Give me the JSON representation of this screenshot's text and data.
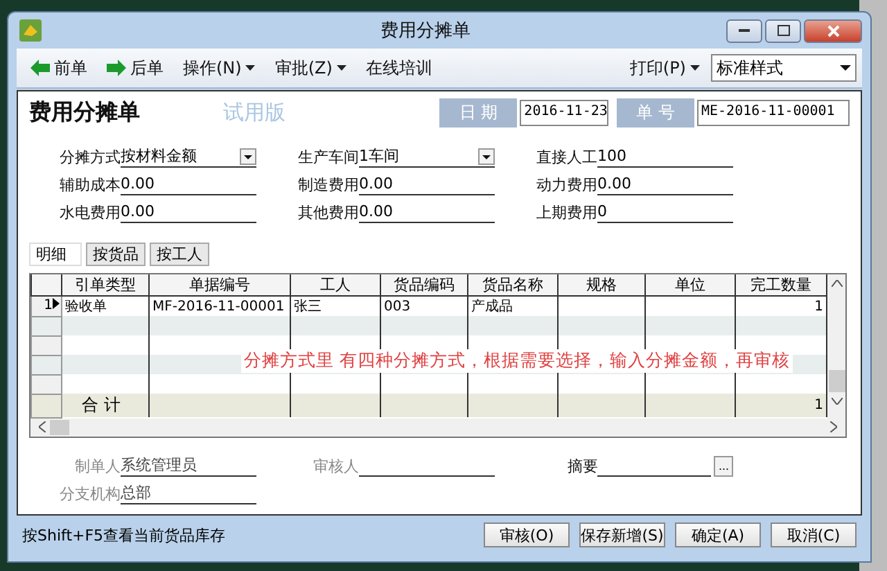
{
  "window": {
    "title": "费用分摊单"
  },
  "toolbar": {
    "items": [
      {
        "label": "前单",
        "kind": "back"
      },
      {
        "label": "后单",
        "kind": "forward"
      },
      {
        "label": "操作(N)",
        "kind": "menu"
      },
      {
        "label": "审批(Z)",
        "kind": "menu"
      },
      {
        "label": "在线培训",
        "kind": "plain"
      }
    ],
    "print": "打印(P)",
    "style_select": "标准样式"
  },
  "header": {
    "title": "费用分摊单",
    "watermark": "试用版",
    "date_label": "日 期",
    "date": "2016-11-23",
    "number_label": "单 号",
    "number": "ME-2016-11-00001"
  },
  "fields": [
    {
      "label": "分摊方式",
      "value": "按材料金额",
      "kind": "dropdown"
    },
    {
      "label": "生产车间",
      "value": "1车间",
      "kind": "dropdown"
    },
    {
      "label": "直接人工",
      "value": "100",
      "kind": "text"
    },
    {
      "label": "辅助成本",
      "value": "0.00",
      "kind": "text"
    },
    {
      "label": "制造费用",
      "value": "0.00",
      "kind": "text"
    },
    {
      "label": "动力费用",
      "value": "0.00",
      "kind": "text"
    },
    {
      "label": "水电费用",
      "value": "0.00",
      "kind": "text"
    },
    {
      "label": "其他费用",
      "value": "0.00",
      "kind": "text"
    },
    {
      "label": "上期费用",
      "value": "0",
      "kind": "text"
    }
  ],
  "tabs": [
    {
      "label": "明细",
      "selected": true
    },
    {
      "label": "按货品",
      "selected": false
    },
    {
      "label": "按工人",
      "selected": false
    }
  ],
  "table": {
    "columns": [
      "引单类型",
      "单据编号",
      "工人",
      "货品编码",
      "货品名称",
      "规格",
      "单位",
      "完工数量"
    ],
    "rows": [
      {
        "row_number": "1",
        "current": true,
        "cells": [
          "验收单",
          "MF-2016-11-00001",
          "张三",
          "003",
          "产成品",
          "",
          "",
          "1"
        ]
      }
    ],
    "total": {
      "label": "合 计",
      "value": "1"
    }
  },
  "annotation": "分摊方式里 有四种分摊方式，根据需要选择，输入分摊金额，再审核",
  "footer_fields": [
    {
      "label": "制单人",
      "value": "系统管理员",
      "kind": "text"
    },
    {
      "label": "审核人",
      "kind": "text"
    },
    {
      "label": "摘要",
      "kind": "lookup",
      "button": "..."
    },
    {
      "label": "分支机构",
      "value": "总部",
      "kind": "text"
    }
  ],
  "status": "按Shift+F5查看当前货品库存",
  "buttons": [
    "审核(O)",
    "保存新增(S)",
    "确定(A)",
    "取消(C)"
  ]
}
